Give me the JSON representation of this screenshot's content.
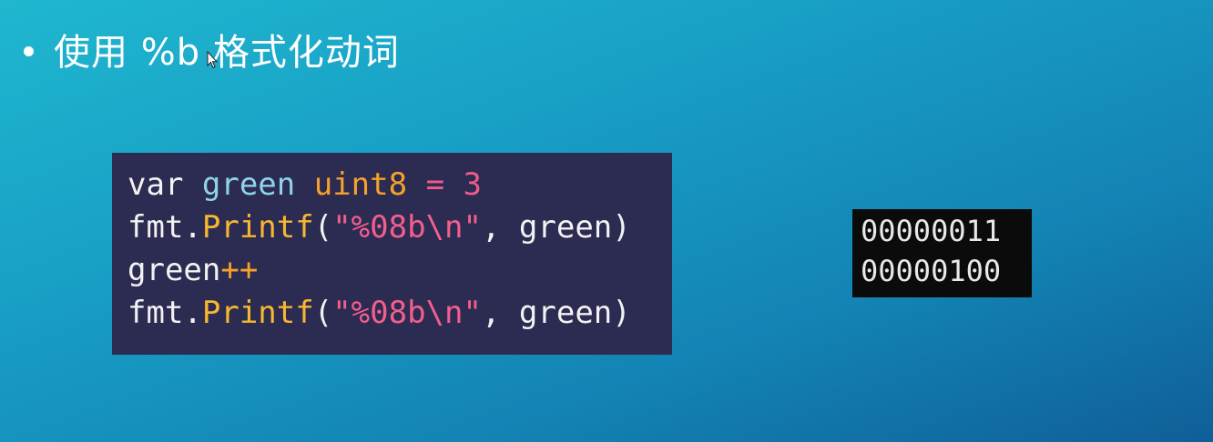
{
  "slide": {
    "title": "使用 %b 格式化动词"
  },
  "code": {
    "lines": [
      [
        {
          "t": "var ",
          "k": "plain"
        },
        {
          "t": "green",
          "k": "var"
        },
        {
          "t": " ",
          "k": "plain"
        },
        {
          "t": "uint8",
          "k": "type"
        },
        {
          "t": " ",
          "k": "plain"
        },
        {
          "t": "=",
          "k": "op"
        },
        {
          "t": " ",
          "k": "plain"
        },
        {
          "t": "3",
          "k": "num"
        }
      ],
      [
        {
          "t": "fmt.",
          "k": "plain"
        },
        {
          "t": "Printf",
          "k": "func"
        },
        {
          "t": "(",
          "k": "plain"
        },
        {
          "t": "\"%08b\\n\"",
          "k": "str"
        },
        {
          "t": ", green)",
          "k": "plain"
        }
      ],
      [
        {
          "t": "green",
          "k": "plain"
        },
        {
          "t": "++",
          "k": "type"
        }
      ],
      [
        {
          "t": "fmt.",
          "k": "plain"
        },
        {
          "t": "Printf",
          "k": "func"
        },
        {
          "t": "(",
          "k": "plain"
        },
        {
          "t": "\"%08b\\n\"",
          "k": "str"
        },
        {
          "t": ", green)",
          "k": "plain"
        }
      ]
    ]
  },
  "output": {
    "lines": [
      "00000011",
      "00000100"
    ]
  },
  "colors": {
    "code_background": "#2c2b52",
    "output_background": "#0b0b0b",
    "keyword_orange": "#f7a12b",
    "string_pink": "#f35f8d",
    "variable_blue": "#8fd3e8"
  }
}
